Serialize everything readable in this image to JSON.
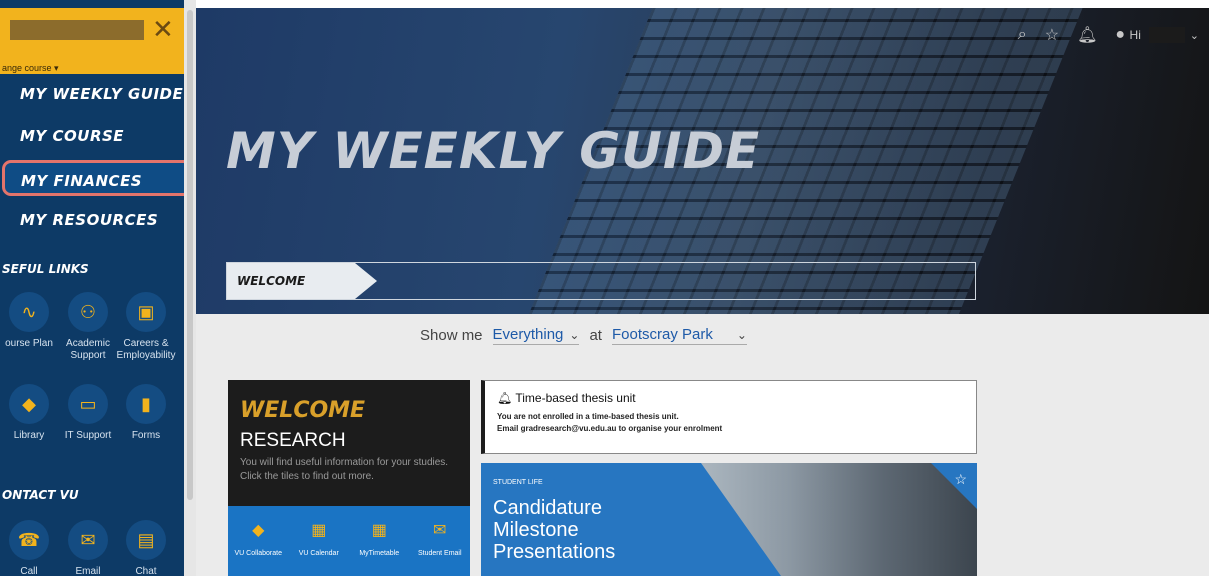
{
  "sidebar": {
    "change_course": "ange course ▾",
    "close_icon": "✕",
    "nav": [
      {
        "label": "MY WEEKLY GUIDE"
      },
      {
        "label": "MY COURSE"
      },
      {
        "label": "MY FINANCES"
      },
      {
        "label": "MY RESOURCES"
      }
    ],
    "useful_links_title": "SEFUL LINKS",
    "useful_links": [
      {
        "label": "ourse Plan",
        "icon": "trend-line-icon",
        "glyph": "∿"
      },
      {
        "label": "Academic Support",
        "icon": "people-icon",
        "glyph": "⚇"
      },
      {
        "label": "Careers & Employability",
        "icon": "briefcase-icon",
        "glyph": "▣"
      },
      {
        "label": "Library",
        "icon": "book-icon",
        "glyph": "◆"
      },
      {
        "label": "IT Support",
        "icon": "laptop-icon",
        "glyph": "▭"
      },
      {
        "label": "Forms",
        "icon": "document-icon",
        "glyph": "▮"
      }
    ],
    "contact_title": "ONTACT VU",
    "contact": [
      {
        "label": "Call",
        "icon": "phone-icon",
        "glyph": "☎"
      },
      {
        "label": "Email",
        "icon": "mail-icon",
        "glyph": "✉"
      },
      {
        "label": "Chat",
        "icon": "chat-icon",
        "glyph": "▤"
      }
    ]
  },
  "header": {
    "hi_label": "Hi"
  },
  "hero": {
    "title": "MY WEEKLY GUIDE",
    "tab_label": "WELCOME"
  },
  "filter": {
    "show_me": "Show me",
    "category": "Everything",
    "at": "at",
    "campus": "Footscray Park"
  },
  "welcome_card": {
    "heading": "WELCOME",
    "subheading": "RESEARCH",
    "text": "You will find useful information for your studies. Click the tiles to find out more.",
    "tiles": [
      {
        "label": "VU Collaborate",
        "glyph": "🎓"
      },
      {
        "label": "VU Calendar",
        "glyph": "▦"
      },
      {
        "label": "MyTimetable",
        "glyph": "▦"
      },
      {
        "label": "Student Email",
        "glyph": "✉"
      }
    ]
  },
  "thesis": {
    "title": "Time-based thesis unit",
    "line1": "You are not enrolled in a time-based thesis unit.",
    "line2": "Email gradresearch@vu.edu.au to organise your enrolment"
  },
  "student_life": {
    "label": "STUDENT LIFE",
    "title": "Candidature Milestone Presentations"
  }
}
